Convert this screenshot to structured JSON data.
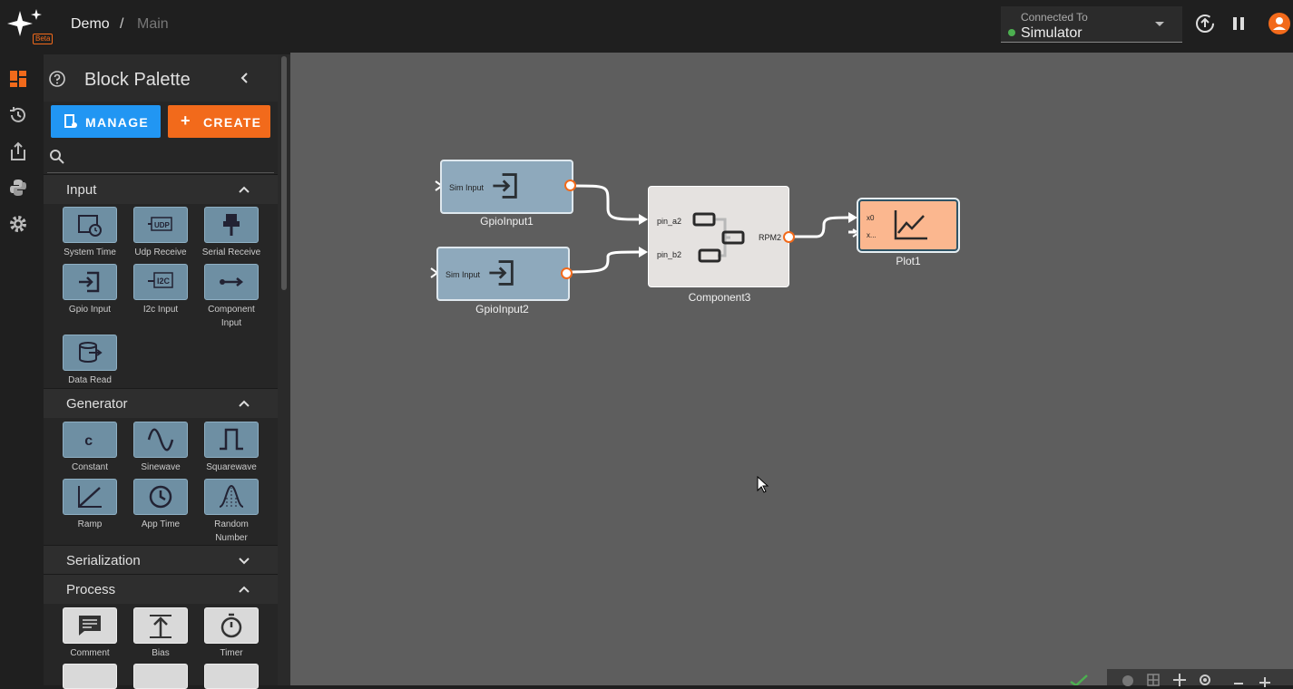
{
  "colors": {
    "accent": "#f26a1b",
    "manage": "#2196f3",
    "input_block": "#8ea9bc",
    "component": "#e5e2e0",
    "plot": "#fbb78f"
  },
  "app": {
    "badge": "Beta",
    "breadcrumb_project": "Demo",
    "breadcrumb_sep": "/",
    "breadcrumb_page": "Main"
  },
  "connection": {
    "label": "Connected To",
    "value": "Simulator",
    "status_color": "#4caf50"
  },
  "palette": {
    "title": "Block Palette",
    "manage_label": "MANAGE",
    "create_label": "CREATE",
    "sections": [
      {
        "title": "Input",
        "expanded": true,
        "blocks": [
          "System Time",
          "Udp Receive",
          "Serial Receive",
          "Gpio Input",
          "I2c Input",
          "Component Input",
          "Data Read"
        ]
      },
      {
        "title": "Generator",
        "expanded": true,
        "blocks": [
          "Constant",
          "Sinewave",
          "Squarewave",
          "Ramp",
          "App Time",
          "Random Number"
        ]
      },
      {
        "title": "Serialization",
        "expanded": false,
        "blocks": []
      },
      {
        "title": "Process",
        "expanded": true,
        "blocks": [
          "Comment",
          "Bias",
          "Timer"
        ]
      }
    ]
  },
  "canvas": {
    "nodes": {
      "gpio1": {
        "name": "GpioInput1",
        "inner": "Sim Input"
      },
      "gpio2": {
        "name": "GpioInput2",
        "inner": "Sim Input"
      },
      "comp3": {
        "name": "Component3",
        "in_a": "pin_a2",
        "in_b": "pin_b2",
        "out": "RPM2"
      },
      "plot1": {
        "name": "Plot1",
        "in0": "x0",
        "in1": "x..."
      }
    }
  },
  "icons": [
    "menu-dashboard-icon",
    "history-icon",
    "export-icon",
    "python-icon",
    "settings-icon",
    "help-icon",
    "collapse-icon",
    "search-icon",
    "upload-icon",
    "pause-icon",
    "user-icon"
  ]
}
